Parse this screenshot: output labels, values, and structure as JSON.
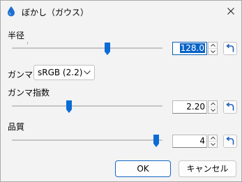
{
  "window": {
    "title": "ぼかし（ガウス）",
    "accent_color": "#0b6cd6"
  },
  "radius": {
    "label": "半径",
    "value": "128.0",
    "slider_fraction": 0.64
  },
  "gamma": {
    "label": "ガンマ:",
    "selected": "sRGB (2.2)"
  },
  "gamma_exponent": {
    "label": "ガンマ指数",
    "value": "2.20",
    "slider_fraction": 0.375
  },
  "quality": {
    "label": "品質",
    "value": "4",
    "slider_fraction": 0.98
  },
  "buttons": {
    "ok": "OK",
    "cancel": "キャンセル"
  }
}
